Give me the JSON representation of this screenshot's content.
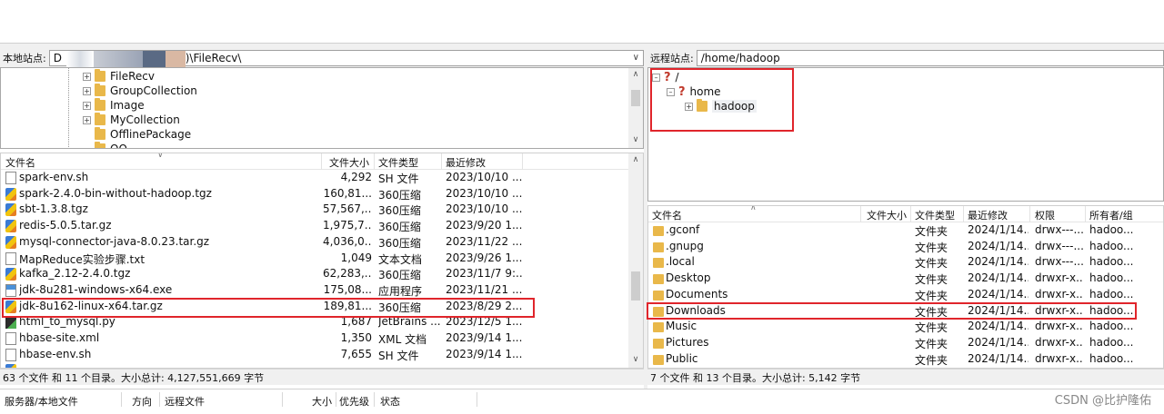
{
  "local": {
    "site_label": "本地站点:",
    "site_path_prefix": "D",
    "site_path_suffix": ")\\FileRecv\\",
    "tree": [
      {
        "label": "FileRecv"
      },
      {
        "label": "GroupCollection"
      },
      {
        "label": "Image"
      },
      {
        "label": "MyCollection"
      },
      {
        "label": "OfflinePackage"
      },
      {
        "label": "QQ"
      }
    ],
    "columns": {
      "name": "文件名",
      "size": "文件大小",
      "type": "文件类型",
      "modified": "最近修改"
    },
    "files": [
      {
        "name": "spark-env.sh",
        "size": "4,292",
        "type": "SH 文件",
        "modified": "2023/10/10 ...",
        "icon": "file-icon"
      },
      {
        "name": "spark-2.4.0-bin-without-hadoop.tgz",
        "size": "160,81...",
        "type": "360压缩",
        "modified": "2023/10/10 ...",
        "icon": "archive-icon"
      },
      {
        "name": "sbt-1.3.8.tgz",
        "size": "57,567,...",
        "type": "360压缩",
        "modified": "2023/10/10 ...",
        "icon": "archive-icon"
      },
      {
        "name": "redis-5.0.5.tar.gz",
        "size": "1,975,7...",
        "type": "360压缩",
        "modified": "2023/9/20 1...",
        "icon": "archive-icon"
      },
      {
        "name": "mysql-connector-java-8.0.23.tar.gz",
        "size": "4,036,0...",
        "type": "360压缩",
        "modified": "2023/11/22 ...",
        "icon": "archive-icon"
      },
      {
        "name": "MapReduce实验步骤.txt",
        "size": "1,049",
        "type": "文本文档",
        "modified": "2023/9/26 1...",
        "icon": "file-icon"
      },
      {
        "name": "kafka_2.12-2.4.0.tgz",
        "size": "62,283,...",
        "type": "360压缩",
        "modified": "2023/11/7 9:...",
        "icon": "archive-icon"
      },
      {
        "name": "jdk-8u281-windows-x64.exe",
        "size": "175,08...",
        "type": "应用程序",
        "modified": "2023/11/21 ...",
        "icon": "exe-icon"
      },
      {
        "name": "jdk-8u162-linux-x64.tar.gz",
        "size": "189,81...",
        "type": "360压缩",
        "modified": "2023/8/29 2...",
        "icon": "archive-icon"
      },
      {
        "name": "html_to_mysql.py",
        "size": "1,687",
        "type": "JetBrains ...",
        "modified": "2023/12/5 1...",
        "icon": "python-icon"
      },
      {
        "name": "hbase-site.xml",
        "size": "1,350",
        "type": "XML 文档",
        "modified": "2023/9/14 1...",
        "icon": "file-icon"
      },
      {
        "name": "hbase-env.sh",
        "size": "7,655",
        "type": "SH 文件",
        "modified": "2023/9/14 1...",
        "icon": "file-icon"
      }
    ],
    "status": "63 个文件 和 11 个目录。大小总计: 4,127,551,669 字节"
  },
  "remote": {
    "site_label": "远程站点:",
    "site_path": "/home/hadoop",
    "tree": [
      {
        "label": "/"
      },
      {
        "label": "home"
      },
      {
        "label": "hadoop"
      }
    ],
    "columns": {
      "name": "文件名",
      "size": "文件大小",
      "type": "文件类型",
      "modified": "最近修改",
      "perms": "权限",
      "owner": "所有者/组"
    },
    "files": [
      {
        "name": ".gconf",
        "type": "文件夹",
        "modified": "2024/1/14...",
        "perms": "drwx---...",
        "owner": "hadoo..."
      },
      {
        "name": ".gnupg",
        "type": "文件夹",
        "modified": "2024/1/14...",
        "perms": "drwx---...",
        "owner": "hadoo..."
      },
      {
        "name": ".local",
        "type": "文件夹",
        "modified": "2024/1/14...",
        "perms": "drwx---...",
        "owner": "hadoo..."
      },
      {
        "name": "Desktop",
        "type": "文件夹",
        "modified": "2024/1/14...",
        "perms": "drwxr-x...",
        "owner": "hadoo..."
      },
      {
        "name": "Documents",
        "type": "文件夹",
        "modified": "2024/1/14...",
        "perms": "drwxr-x...",
        "owner": "hadoo..."
      },
      {
        "name": "Downloads",
        "type": "文件夹",
        "modified": "2024/1/14...",
        "perms": "drwxr-x...",
        "owner": "hadoo..."
      },
      {
        "name": "Music",
        "type": "文件夹",
        "modified": "2024/1/14...",
        "perms": "drwxr-x...",
        "owner": "hadoo..."
      },
      {
        "name": "Pictures",
        "type": "文件夹",
        "modified": "2024/1/14...",
        "perms": "drwxr-x...",
        "owner": "hadoo..."
      },
      {
        "name": "Public",
        "type": "文件夹",
        "modified": "2024/1/14...",
        "perms": "drwxr-x...",
        "owner": "hadoo..."
      }
    ],
    "status": "7 个文件 和 13 个目录。大小总计: 5,142 字节"
  },
  "queue": {
    "columns": [
      "服务器/本地文件",
      "方向",
      "远程文件",
      "大小",
      "优先级",
      "状态"
    ]
  },
  "watermark": "CSDN @比护隆佑",
  "colors": {
    "highlight": "#e0252b",
    "folder": "#e9b84a"
  }
}
